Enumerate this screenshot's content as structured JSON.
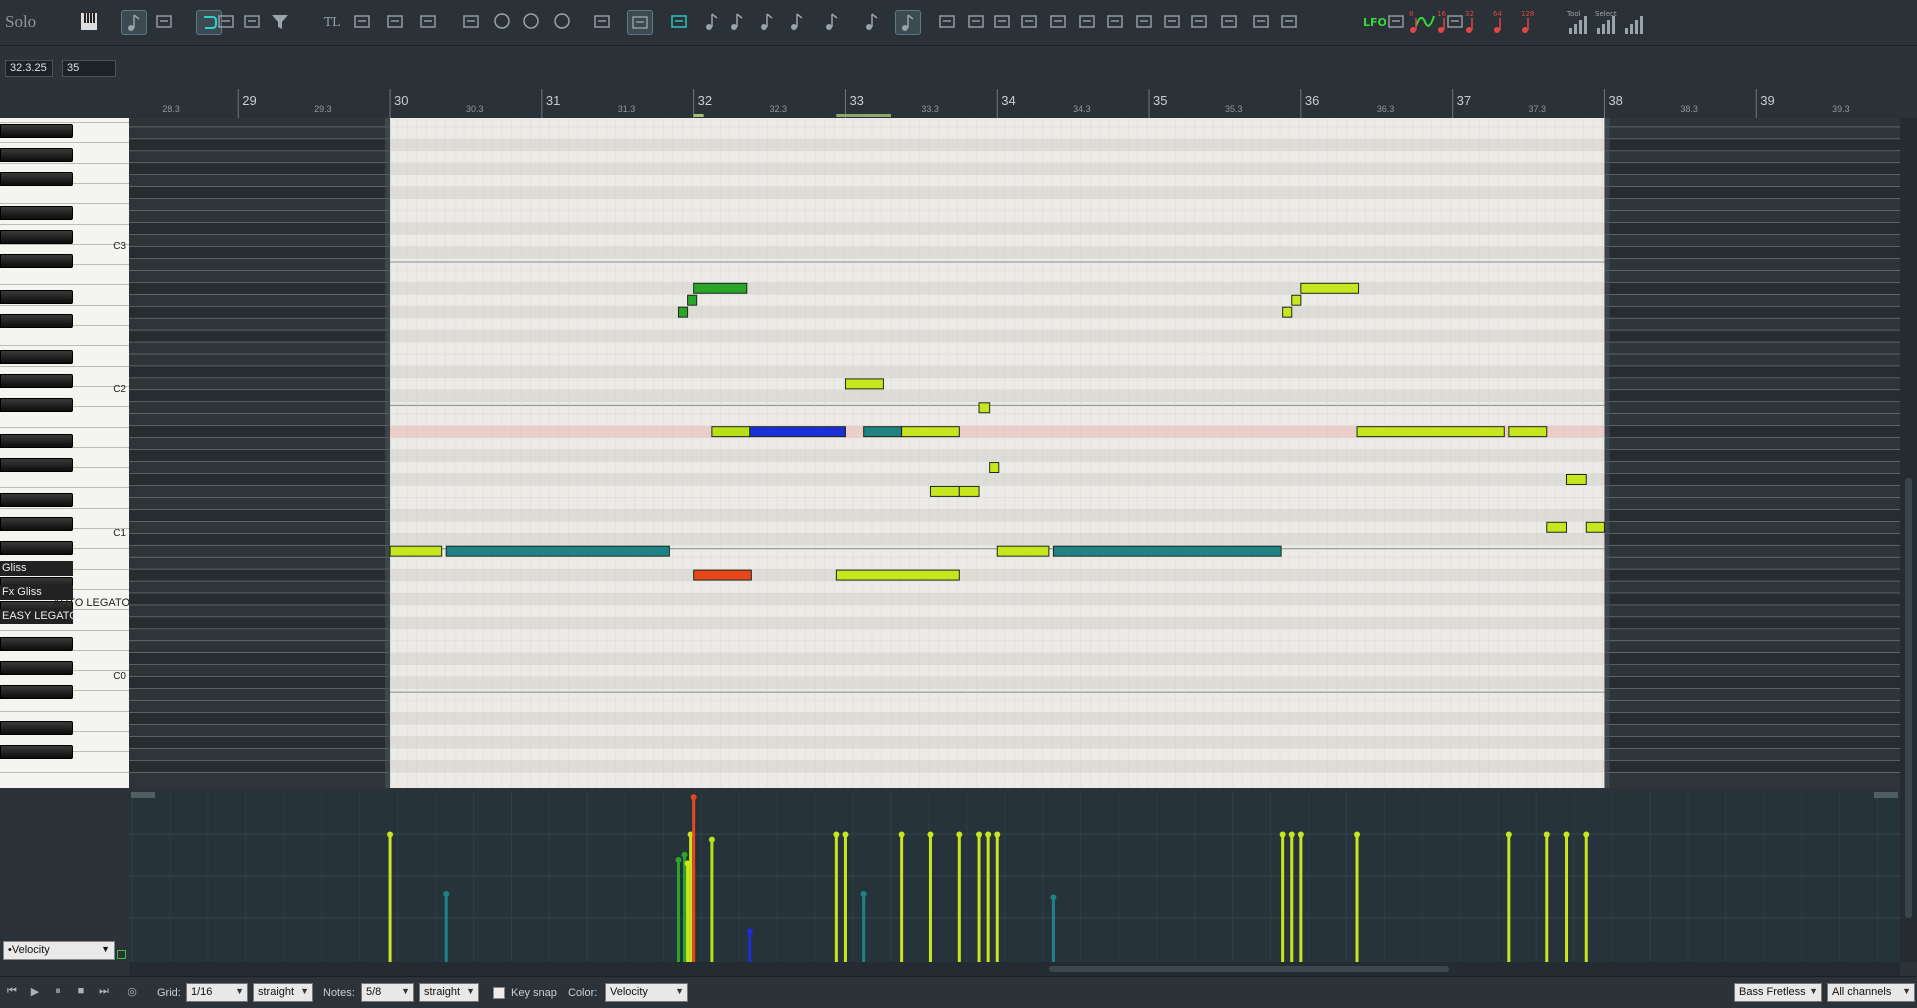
{
  "toolbar": {
    "solo_label": "Solo",
    "tl_label": "TL",
    "lfo_label": "LFO",
    "note_lengths": [
      "8",
      "16",
      "32",
      "64",
      "128"
    ],
    "tool_labels": [
      "Tool",
      "Select",
      ""
    ],
    "icons": [
      "keyboard-icon",
      "note-list-icon",
      "pitch-icon",
      "loop-icon",
      "link-icon",
      "velocity-icon",
      "filter-icon",
      "tl-icon",
      "split-icon",
      "merge-icon",
      "move-left-icon",
      "move-right-icon",
      "zoom-in-icon",
      "zoom-out-icon",
      "zoom-fit-icon",
      "undo-icon",
      "grid-icon",
      "snap-icon",
      "whole-note-icon",
      "half-note-icon",
      "quarter-note-icon",
      "eighth-note-icon",
      "sixteenth-note-icon",
      "triplet-note-icon",
      "dotted-note-icon",
      "legato-icon",
      "quantize-icon",
      "humanize-icon",
      "chord-icon",
      "arpeggio-icon",
      "strum-icon",
      "glue-icon",
      "slice-icon",
      "cut-icon",
      "draw-icon",
      "erase-icon",
      "find-icon",
      "auto-icon",
      "lfo-icon",
      "mouse-icon",
      "curve-icon",
      "list-icon"
    ]
  },
  "position": {
    "time": "32.3.25",
    "value": "35"
  },
  "ruler": {
    "bars": [
      "29",
      "30",
      "31",
      "32",
      "33",
      "34",
      "35",
      "36",
      "37",
      "38",
      "39"
    ],
    "beats": [
      "28.3",
      "29.3",
      "30.3",
      "31.3",
      "32.3",
      "33.3",
      "34.3",
      "35.3",
      "36.3",
      "37.3",
      "38.3",
      "39.3"
    ]
  },
  "keyboard": {
    "octave_labels": [
      "C3",
      "C2",
      "C1",
      "C0"
    ],
    "articulations": [
      "Gliss",
      "Fx Gliss",
      "EASY LEGATO"
    ],
    "auto_legato": "AUTO LEGATO"
  },
  "notes": [
    {
      "bar": 30.0,
      "len": 0.34,
      "row": 36,
      "color": "#c8e61e"
    },
    {
      "bar": 30.37,
      "len": 1.47,
      "row": 36,
      "color": "#1f8285"
    },
    {
      "bar": 31.9,
      "len": 0.06,
      "row": 16,
      "color": "#2aa52a"
    },
    {
      "bar": 31.96,
      "len": 0.06,
      "row": 15,
      "color": "#2aa52a"
    },
    {
      "bar": 32.0,
      "len": 0.35,
      "row": 14,
      "color": "#2aa52a"
    },
    {
      "bar": 32.12,
      "len": 0.25,
      "row": 26,
      "color": "#b8e019"
    },
    {
      "bar": 32.37,
      "len": 0.63,
      "row": 26,
      "color": "#1c2fd6"
    },
    {
      "bar": 32.0,
      "len": 0.38,
      "row": 38,
      "color": "#e8471b"
    },
    {
      "bar": 33.0,
      "len": 0.25,
      "row": 22,
      "color": "#c8e61e"
    },
    {
      "bar": 33.12,
      "len": 0.25,
      "row": 26,
      "color": "#1f8285"
    },
    {
      "bar": 33.37,
      "len": 0.38,
      "row": 26,
      "color": "#c8e61e"
    },
    {
      "bar": 32.94,
      "len": 0.81,
      "row": 38,
      "color": "#c8e61e"
    },
    {
      "bar": 33.56,
      "len": 0.19,
      "row": 31,
      "color": "#c8e61e"
    },
    {
      "bar": 33.75,
      "len": 0.13,
      "row": 31,
      "color": "#c8e61e"
    },
    {
      "bar": 33.88,
      "len": 0.07,
      "row": 24,
      "color": "#c8e61e"
    },
    {
      "bar": 33.95,
      "len": 0.06,
      "row": 29,
      "color": "#c8e61e"
    },
    {
      "bar": 34.0,
      "len": 0.34,
      "row": 36,
      "color": "#c8e61e"
    },
    {
      "bar": 34.37,
      "len": 1.5,
      "row": 36,
      "color": "#1f8285"
    },
    {
      "bar": 35.88,
      "len": 0.06,
      "row": 16,
      "color": "#c8e61e"
    },
    {
      "bar": 35.94,
      "len": 0.06,
      "row": 15,
      "color": "#c8e61e"
    },
    {
      "bar": 36.0,
      "len": 0.38,
      "row": 14,
      "color": "#c8e61e"
    },
    {
      "bar": 36.37,
      "len": 0.97,
      "row": 26,
      "color": "#c8e61e"
    },
    {
      "bar": 37.37,
      "len": 0.25,
      "row": 26,
      "color": "#c8e61e"
    },
    {
      "bar": 37.62,
      "len": 0.13,
      "row": 34,
      "color": "#c8e61e"
    },
    {
      "bar": 37.75,
      "len": 0.13,
      "row": 30,
      "color": "#c8e61e"
    },
    {
      "bar": 37.88,
      "len": 0.12,
      "row": 34,
      "color": "#c8e61e"
    }
  ],
  "velocities": [
    {
      "bar": 30.0,
      "v": 0.75,
      "color": "#c8e61e"
    },
    {
      "bar": 30.37,
      "v": 0.4,
      "color": "#1f8285"
    },
    {
      "bar": 31.9,
      "v": 0.6,
      "color": "#2aa52a"
    },
    {
      "bar": 31.94,
      "v": 0.63,
      "color": "#2aa52a"
    },
    {
      "bar": 31.96,
      "v": 0.58,
      "color": "#c8e61e"
    },
    {
      "bar": 31.98,
      "v": 0.75,
      "color": "#c8e61e"
    },
    {
      "bar": 32.0,
      "v": 0.97,
      "color": "#e8471b"
    },
    {
      "bar": 32.12,
      "v": 0.72,
      "color": "#b8e019"
    },
    {
      "bar": 32.37,
      "v": 0.18,
      "color": "#1c2fd6"
    },
    {
      "bar": 32.94,
      "v": 0.75,
      "color": "#c8e61e"
    },
    {
      "bar": 33.0,
      "v": 0.75,
      "color": "#c8e61e"
    },
    {
      "bar": 33.12,
      "v": 0.4,
      "color": "#1f8285"
    },
    {
      "bar": 33.37,
      "v": 0.75,
      "color": "#c8e61e"
    },
    {
      "bar": 33.56,
      "v": 0.75,
      "color": "#c8e61e"
    },
    {
      "bar": 33.75,
      "v": 0.75,
      "color": "#c8e61e"
    },
    {
      "bar": 33.88,
      "v": 0.75,
      "color": "#c8e61e"
    },
    {
      "bar": 33.94,
      "v": 0.75,
      "color": "#c8e61e"
    },
    {
      "bar": 34.0,
      "v": 0.75,
      "color": "#c8e61e"
    },
    {
      "bar": 34.37,
      "v": 0.38,
      "color": "#1f8285"
    },
    {
      "bar": 35.88,
      "v": 0.75,
      "color": "#c8e61e"
    },
    {
      "bar": 35.94,
      "v": 0.75,
      "color": "#c8e61e"
    },
    {
      "bar": 36.0,
      "v": 0.75,
      "color": "#c8e61e"
    },
    {
      "bar": 36.37,
      "v": 0.75,
      "color": "#c8e61e"
    },
    {
      "bar": 37.37,
      "v": 0.75,
      "color": "#c8e61e"
    },
    {
      "bar": 37.62,
      "v": 0.75,
      "color": "#c8e61e"
    },
    {
      "bar": 37.75,
      "v": 0.75,
      "color": "#c8e61e"
    },
    {
      "bar": 37.88,
      "v": 0.75,
      "color": "#c8e61e"
    }
  ],
  "velocity_lane": {
    "selected": "•Velocity"
  },
  "bottom": {
    "grid_label": "Grid:",
    "grid_value": "1/16",
    "grid_mode": "straight",
    "notes_label": "Notes:",
    "notes_value": "5/8",
    "notes_mode": "straight",
    "keysnap_label": "Key snap",
    "color_label": "Color:",
    "color_value": "Velocity",
    "instrument": "Bass Fretless",
    "channels": "All channels"
  }
}
